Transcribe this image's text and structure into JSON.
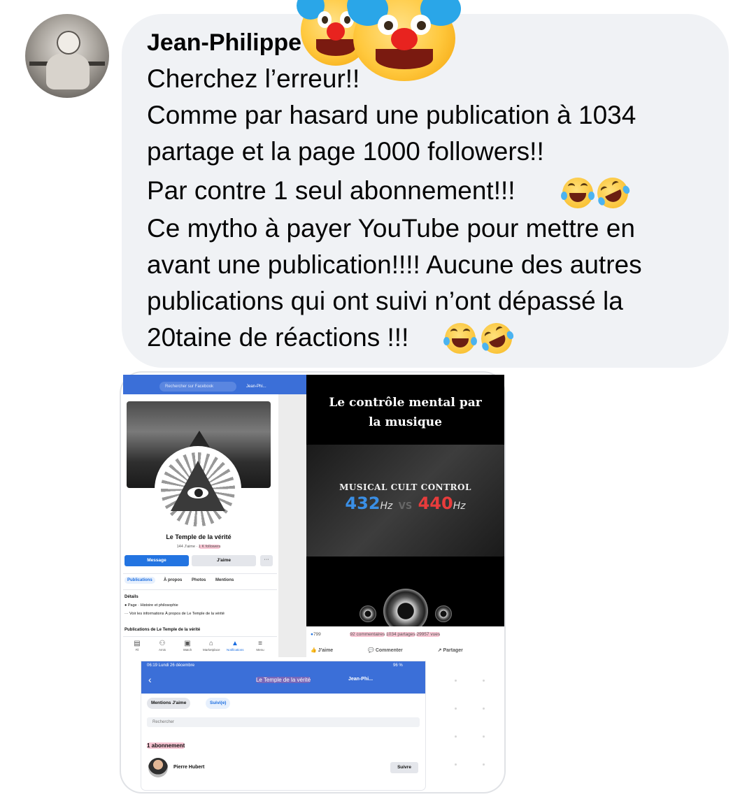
{
  "comment": {
    "author": "Jean-Philippe",
    "lines": [
      "Cherchez l’erreur!!",
      "Comme par hasard une publication à 1034",
      "partage et la page 1000 followers!!",
      "Par contre 1 seul abonnement!!!",
      "Ce mytho à payer YouTube pour mettre en",
      "avant une publication!!!! Aucune des autres",
      "publications qui ont suivi n’ont dépassé la",
      "20taine de réactions !!!"
    ],
    "emoji_after_lines": [
      "laughing-tears-emoji",
      "rolling-laughing-emoji"
    ],
    "sticker": "clown-face-emoji"
  },
  "fb_page_screenshot": {
    "search_placeholder": "Rechercher sur Facebook",
    "user_chip": "Jean-Phi...",
    "page_name": "Le Temple de la vérité",
    "likes_text": "144 J'aime",
    "sep": " · ",
    "followers_text": "1 K followers",
    "buttons": {
      "message": "Message",
      "like": "J'aime",
      "more": "···"
    },
    "tabs": [
      "Publications",
      "À propos",
      "Photos",
      "Mentions"
    ],
    "details_title": "Détails",
    "details_category": "Page · Histoire et philosophie",
    "details_more": "Voir les informations À propos de Le Temple de la vérité",
    "publications_title": "Publications de Le Temple de la vérité",
    "nav": [
      "Fil",
      "Amis",
      "Watch",
      "Marketplace",
      "Notifications",
      "Menu"
    ]
  },
  "video_post": {
    "title_line1": "Le contrôle mental par",
    "title_line2": "la musique",
    "overlay_title": "MUSICAL CULT CONTROL",
    "freq_a": "432",
    "freq_b": "440",
    "hz": "Hz",
    "vs": "VS",
    "reactions": "799",
    "comments": "92 commentaires",
    "shares": "1034 partages",
    "views": "29957 vues",
    "actions": [
      "J'aime",
      "Commenter",
      "Partager"
    ]
  },
  "subscriptions_screenshot": {
    "status_time": "06:19  Lundi 26 décembre",
    "status_battery": "96 %",
    "title": "Le Temple de la vérité",
    "user_chip": "Jean-Phi...",
    "pill_a": "Mentions J'aime",
    "pill_b": "Suivi(e)",
    "search_placeholder": "Rechercher",
    "count": "1 abonnement",
    "person_name": "Pierre Hubert",
    "follow_label": "Suivre"
  },
  "colors": {
    "bubble": "#f0f2f5",
    "fb_blue": "#3b6fd8",
    "highlight": "#ec5a82"
  }
}
